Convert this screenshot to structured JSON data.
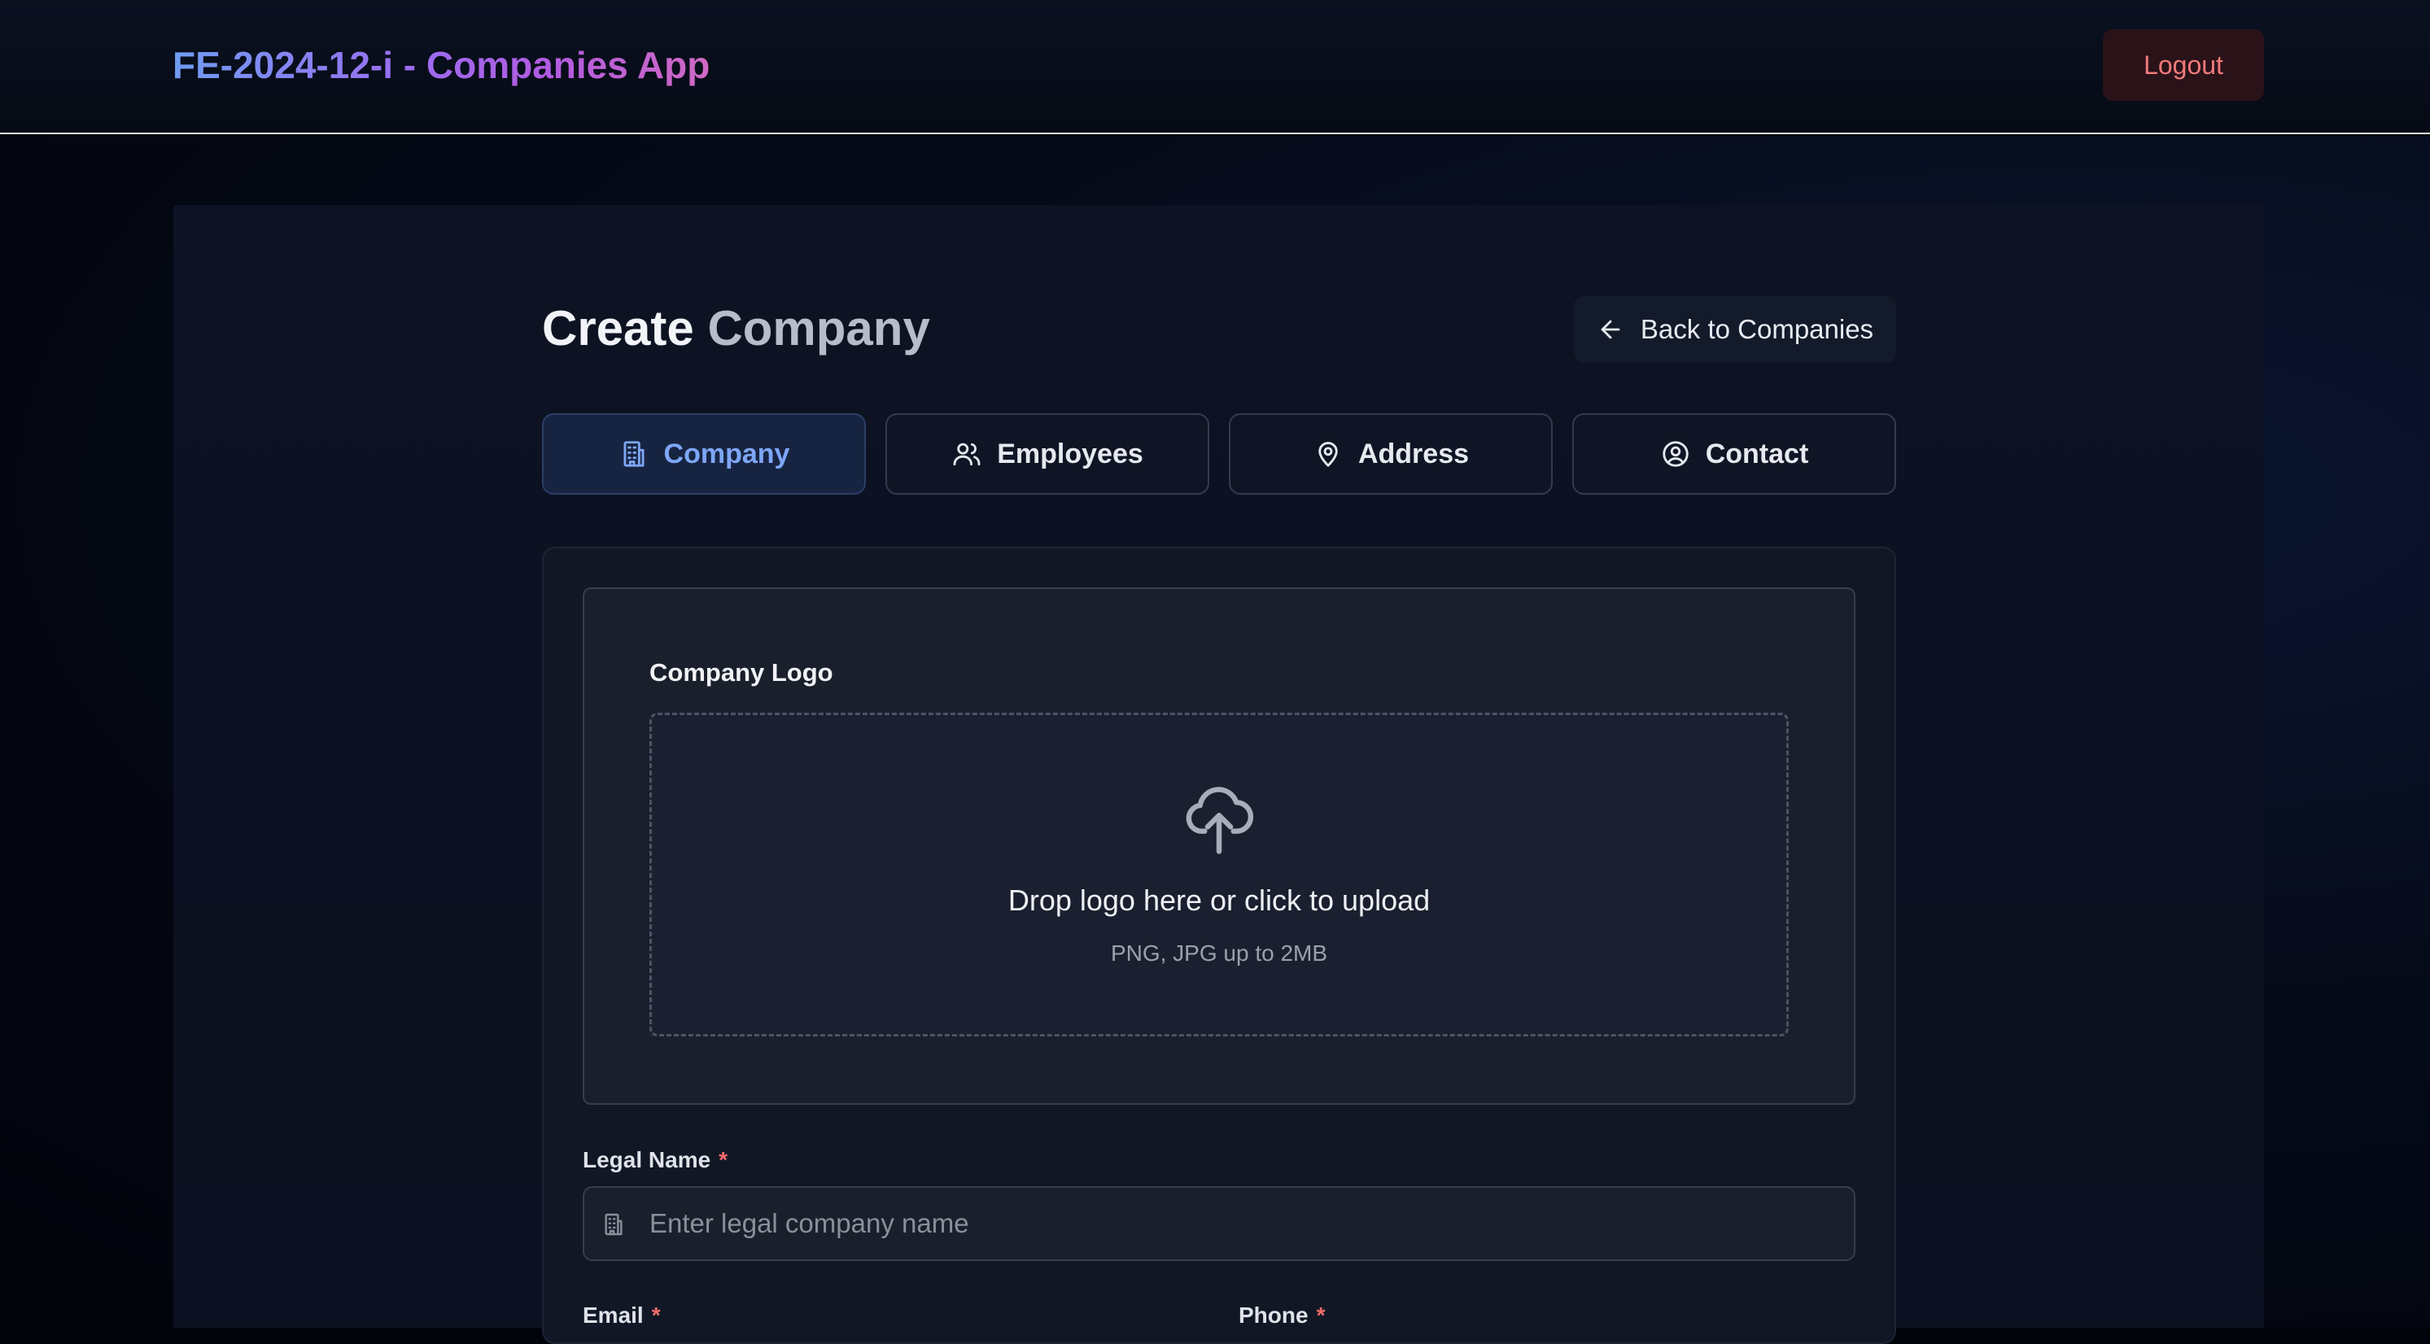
{
  "header": {
    "app_title": "FE-2024-12-i - Companies App",
    "logout_label": "Logout"
  },
  "page": {
    "title_part1": "Create",
    "title_part2": "Company",
    "back_label": "Back to Companies"
  },
  "tabs": [
    {
      "label": "Company",
      "icon": "building-icon",
      "active": true
    },
    {
      "label": "Employees",
      "icon": "users-icon",
      "active": false
    },
    {
      "label": "Address",
      "icon": "map-pin-icon",
      "active": false
    },
    {
      "label": "Contact",
      "icon": "user-circle-icon",
      "active": false
    }
  ],
  "logo_upload": {
    "label": "Company Logo",
    "title": "Drop logo here or click to upload",
    "hint": "PNG, JPG up to 2MB",
    "icon": "cloud-upload-icon"
  },
  "fields": {
    "legal_name": {
      "label": "Legal Name",
      "required_mark": "*",
      "placeholder": "Enter legal company name",
      "icon": "building-icon"
    },
    "email": {
      "label": "Email",
      "required_mark": "*"
    },
    "phone": {
      "label": "Phone",
      "required_mark": "*"
    }
  },
  "colors": {
    "accent": "#7ea6f7",
    "danger": "#f07a7a",
    "required": "#f26b6b"
  }
}
